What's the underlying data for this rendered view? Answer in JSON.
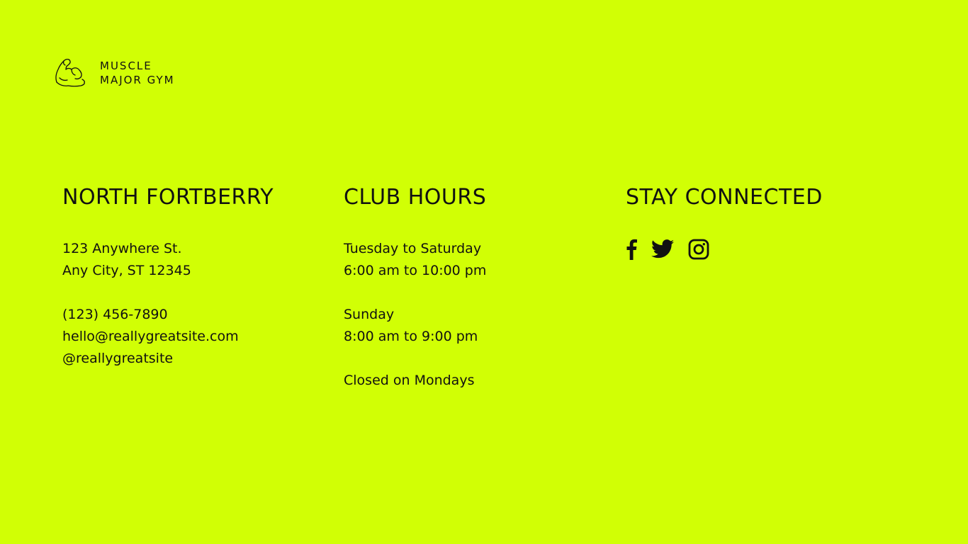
{
  "brand": {
    "line1": "MUSCLE",
    "line2": "MAJOR GYM",
    "logo_icon": "flexed-arm-icon"
  },
  "location": {
    "heading": "NORTH FORTBERRY",
    "address_line1": "123 Anywhere St.",
    "address_line2": "Any City, ST 12345",
    "phone": "(123) 456-7890",
    "email": "hello@reallygreatsite.com",
    "handle": "@reallygreatsite"
  },
  "hours": {
    "heading": "CLUB HOURS",
    "weekday_label": "Tuesday to Saturday",
    "weekday_time": "6:00 am to 10:00 pm",
    "sunday_label": "Sunday",
    "sunday_time": "8:00 am to 9:00 pm",
    "closed_note": "Closed on Mondays"
  },
  "social": {
    "heading": "STAY CONNECTED",
    "icons": [
      "facebook-icon",
      "twitter-icon",
      "instagram-icon"
    ]
  },
  "colors": {
    "background": "#d1ff05",
    "text": "#111111"
  }
}
